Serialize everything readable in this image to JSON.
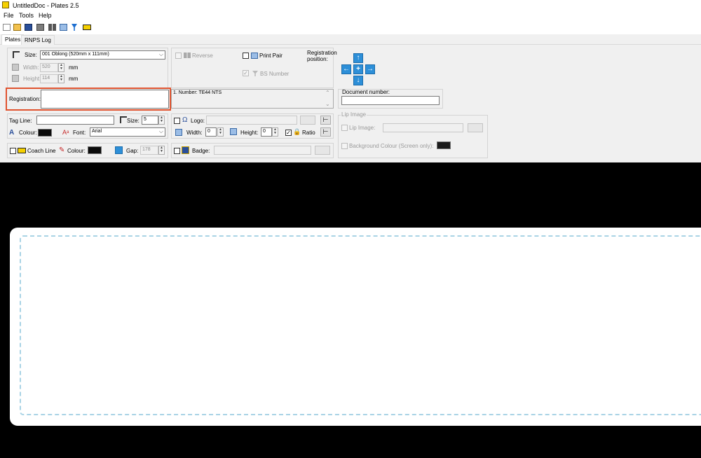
{
  "window": {
    "title": "UntitledDoc - Plates 2.5"
  },
  "menu": [
    "File",
    "Tools",
    "Help"
  ],
  "toolbar_icons": [
    "new-icon",
    "open-icon",
    "save-icon",
    "print-icon",
    "align-icon",
    "copy-icon",
    "filter-icon",
    "plate-icon"
  ],
  "tabs": [
    {
      "label": "Plates",
      "active": true
    },
    {
      "label": "RNPS Log",
      "active": false
    }
  ],
  "plate_size": {
    "size_label": "Size:",
    "size_value": "001 Oblong (520mm x 111mm)",
    "width_label": "Width:",
    "width_value": "520",
    "width_unit": "mm",
    "height_label": "Height:",
    "height_value": "114",
    "height_unit": "mm"
  },
  "options": {
    "reverse_label": "Reverse",
    "print_pair_label": "Print Pair",
    "bs_number_label": "BS Number"
  },
  "registration_position": {
    "label_line1": "Registration",
    "label_line2": "position:"
  },
  "registration": {
    "label": "Registration:",
    "value": "",
    "list_text": "1. Number: TE44 NTS"
  },
  "document_number": {
    "label": "Document number:",
    "value": ""
  },
  "tag_line": {
    "label": "Tag Line:",
    "value": "",
    "size_label": "Size:",
    "size_value": "5",
    "colour_label": "Colour:",
    "font_label": "Font:",
    "font_value": "Arial"
  },
  "logo": {
    "label": "Logo:",
    "value": "",
    "width_label": "Width:",
    "width_value": "0",
    "height_label": "Height:",
    "height_value": "0",
    "ratio_label": "Ratio"
  },
  "lip_image": {
    "group_label": "Lip Image",
    "lip_image_label": "Lip Image:",
    "background_label": "Background Colour (Screen only):"
  },
  "coach_line": {
    "label": "Coach Line",
    "colour_label": "Colour:",
    "gap_label": "Gap:",
    "gap_value": "178"
  },
  "badge": {
    "label": "Badge:",
    "value": ""
  },
  "colors": {
    "highlight_border": "#e0532f",
    "dash_border": "#a9d3e5",
    "canvas_bg": "#000000",
    "arrow_blue": "#2d8fd8"
  }
}
